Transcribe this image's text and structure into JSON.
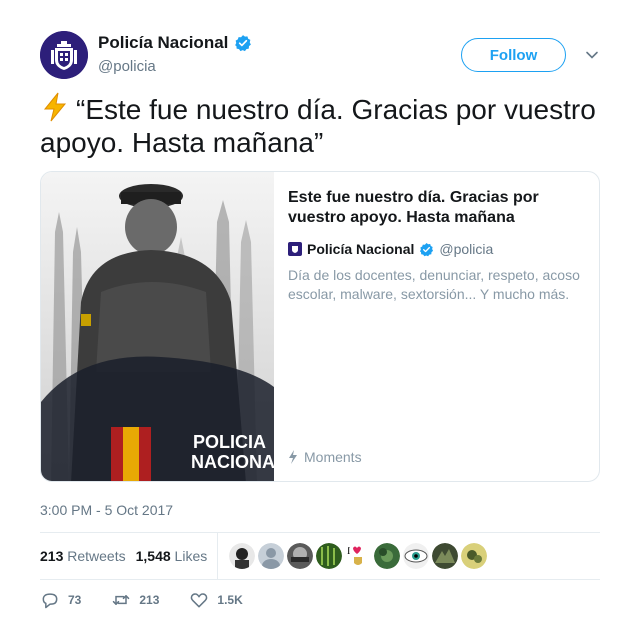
{
  "user": {
    "display_name": "Policía Nacional",
    "handle": "@policia",
    "verified_icon": "verified-badge-icon",
    "avatar_icon": "police-crest-icon"
  },
  "follow_label": "Follow",
  "tweet": {
    "emoji_icon": "lightning-bolt-icon",
    "text": "“Este fue nuestro día. Gracias por vuestro apoyo. Hasta mañana”"
  },
  "card": {
    "title": "Este fue nuestro día. Gracias por vuestro apoyo. Hasta mañana",
    "author_name": "Policía Nacional",
    "author_handle": "@policia",
    "description": "Día de los docentes, denunciar, respeto, acoso escolar, malware, sextorsión... Y mucho más.",
    "moments_label": "Moments",
    "image_text": [
      "POLICIA",
      "NACIONA"
    ]
  },
  "timestamp": "3:00 PM - 5 Oct 2017",
  "stats": {
    "retweets_count": "213",
    "retweets_label": "Retweets",
    "likes_count": "1,548",
    "likes_label": "Likes"
  },
  "actions": {
    "replies": "73",
    "retweets": "213",
    "likes": "1.5K"
  },
  "colors": {
    "accent": "#1da1f2",
    "text": "#14171a",
    "muted": "#657786"
  }
}
